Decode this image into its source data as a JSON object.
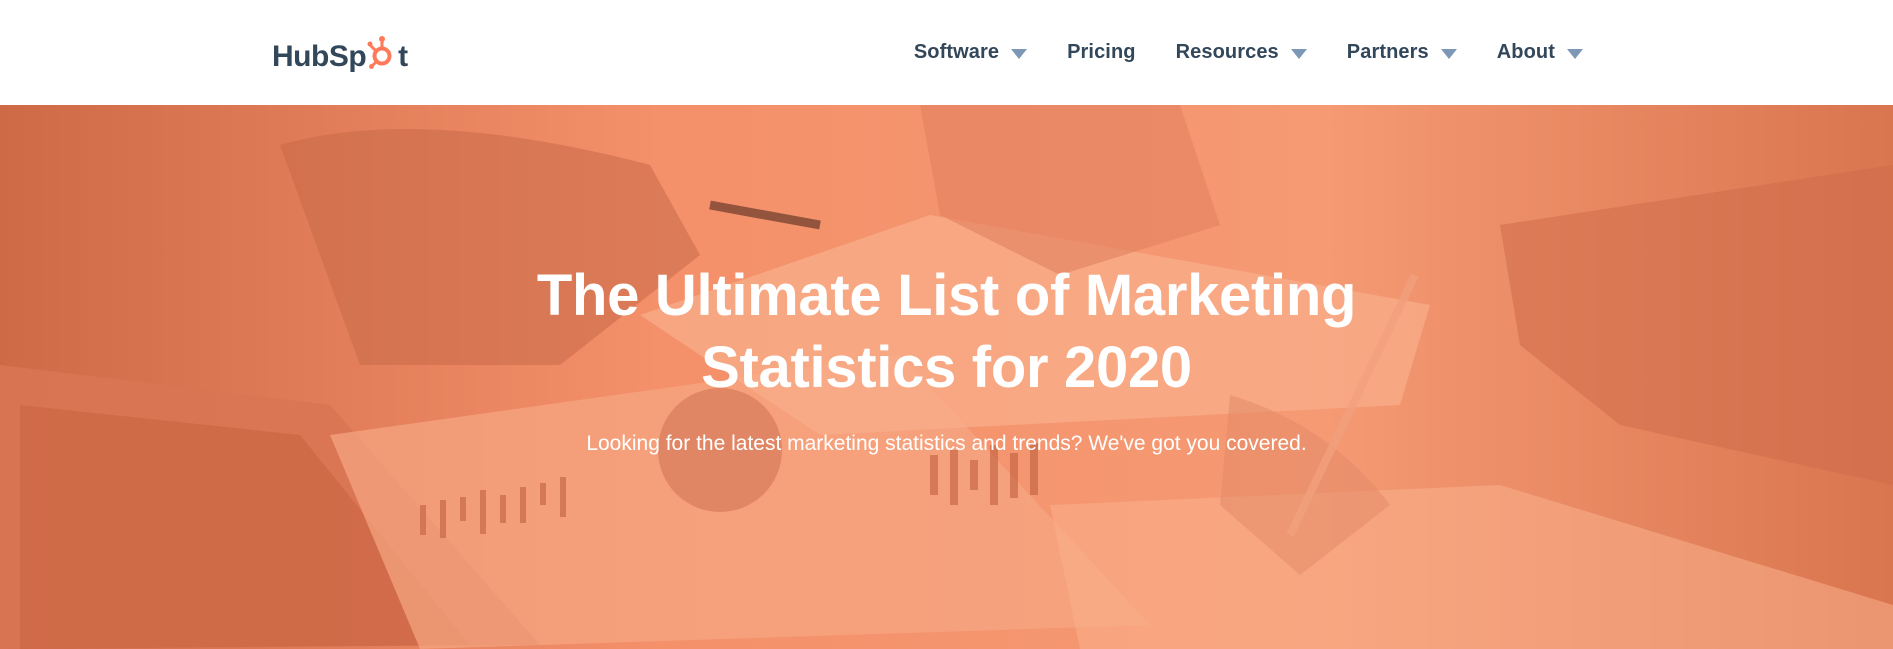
{
  "brand": {
    "name_part1": "HubSp",
    "name_part2": "t",
    "icon": "hubspot-sprocket-icon",
    "accent": "#ff7a59",
    "text_color": "#33475b"
  },
  "nav": {
    "items": [
      {
        "label": "Software",
        "has_dropdown": true
      },
      {
        "label": "Pricing",
        "has_dropdown": false
      },
      {
        "label": "Resources",
        "has_dropdown": true
      },
      {
        "label": "Partners",
        "has_dropdown": true
      },
      {
        "label": "About",
        "has_dropdown": true
      }
    ],
    "caret_icon": "caret-down-icon",
    "caret_color": "#7c98b6"
  },
  "hero": {
    "title_line1": "The Ultimate List of Marketing",
    "title_line2": "Statistics for 2020",
    "subtitle": "Looking for the latest marketing statistics and trends? We've got you covered.",
    "overlay_color": "#f08a65",
    "background_image": "business-people-reviewing-financial-charts-photo"
  }
}
